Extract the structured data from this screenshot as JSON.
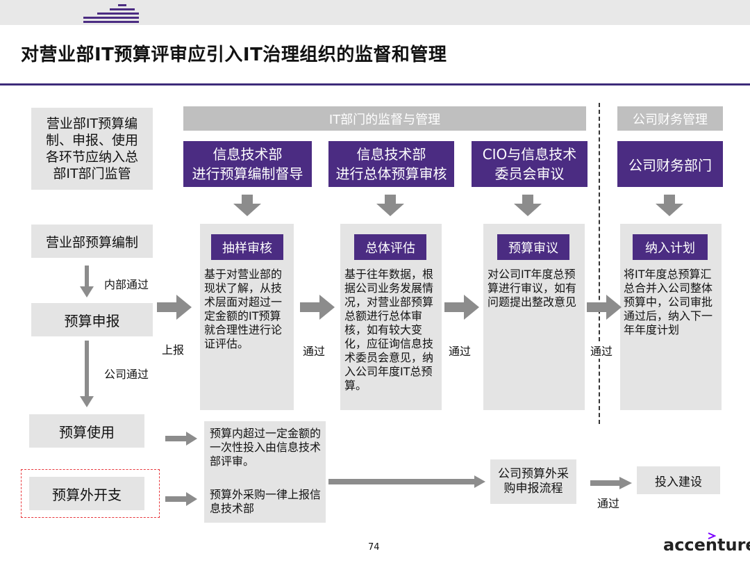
{
  "slide": {
    "title": "对营业部IT预算评审应引入IT治理组织的监督和管理",
    "page_number": "74",
    "brand": "accenture"
  },
  "left_column": {
    "intro": "营业部IT预算编制、申报、使用各环节应纳入总部IT部门监管",
    "step1": "营业部预算编制",
    "step1_to_step2_label": "内部通过",
    "step2": "预算申报",
    "step2_to_step3_label": "公司通过",
    "step3": "预算使用",
    "step4": "预算外开支"
  },
  "headers": {
    "it_dept": "IT部门的监督与管理",
    "finance": "公司财务管理"
  },
  "departments": [
    {
      "line1": "信息技术部",
      "line2": "进行预算编制督导"
    },
    {
      "line1": "信息技术部",
      "line2": "进行总体预算审核"
    },
    {
      "line1": "CIO与信息技术",
      "line2": "委员会审议"
    },
    {
      "line1": "公司财务部门",
      "line2": ""
    }
  ],
  "stages": [
    {
      "label": "抽样审核",
      "text": "基于对营业部的现状了解，从技术层面对超过一定金额的IT预算就合理性进行论证评估。"
    },
    {
      "label": "总体评估",
      "text": "基于往年数据，根据公司业务发展情况，对营业部预算总额进行总体审核，如有较大变化，应征询信息技术委员会意见，纳入公司年度IT总预算。"
    },
    {
      "label": "预算审议",
      "text": "对公司IT年度总预算进行审议，如有问题提出整改意见"
    },
    {
      "label": "纳入计划",
      "text": "将IT年度总预算汇总合并入公司整体预算中，公司审批通过后，纳入下一年年度计划"
    }
  ],
  "flow_labels": {
    "report": "上报",
    "pass1": "通过",
    "pass2": "通过",
    "pass3": "通过",
    "pass4": "通过"
  },
  "bottom": {
    "usage_text1": "预算内超过一定金额的一次性投入由信息技术部评审。",
    "usage_text2": "预算外采购一律上报信息技术部",
    "external_process": "公司预算外采购申报流程",
    "build": "投入建设"
  },
  "colors": {
    "purple": "#4b2c82",
    "panel_gray": "#e4e4e4",
    "header_gray": "#bfbfbf",
    "arrow_gray": "#8c8c8c",
    "red_dashed": "#e8363b"
  }
}
